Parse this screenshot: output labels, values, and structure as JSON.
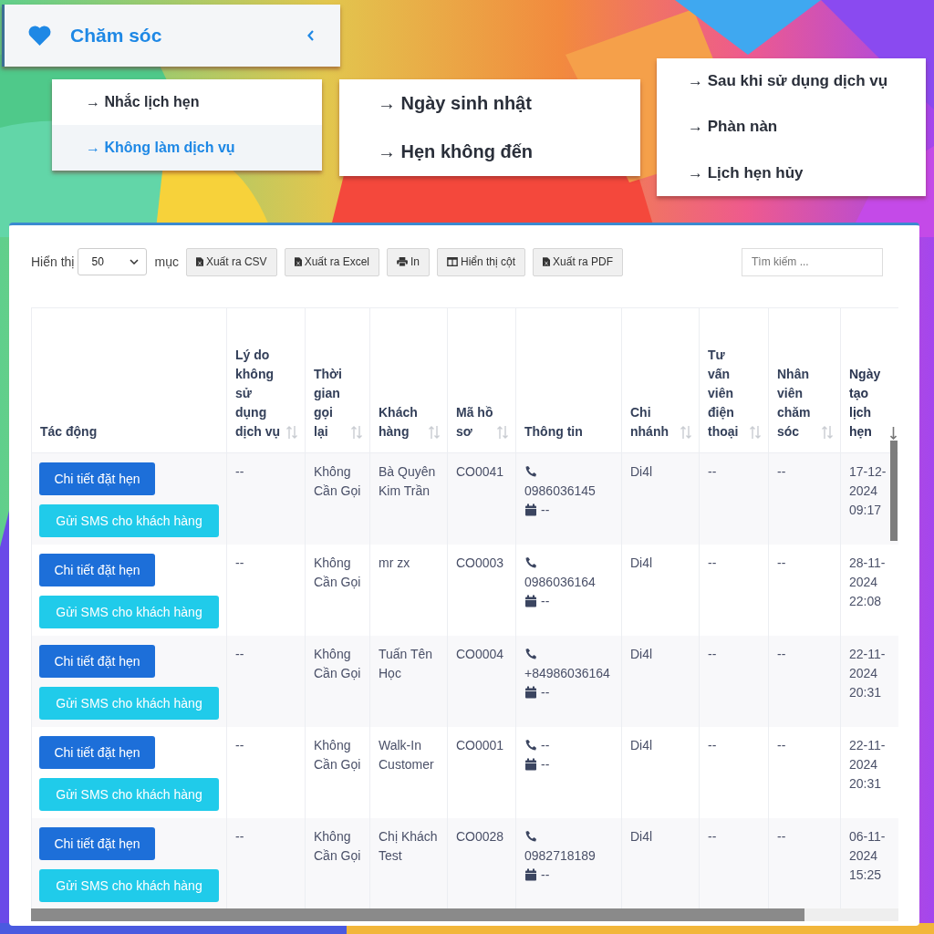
{
  "menu": {
    "title": "Chăm sóc",
    "submenus": [
      {
        "items": [
          {
            "label": "→ Nhắc lịch hẹn",
            "selected": false
          },
          {
            "label": "→ Không làm dịch vụ",
            "selected": true
          }
        ]
      },
      {
        "items": [
          {
            "label": "→ Ngày sinh nhật",
            "selected": false
          },
          {
            "label": "→ Hẹn không đến",
            "selected": false
          }
        ]
      },
      {
        "items": [
          {
            "label": "→ Sau khi sử dụng dịch vụ",
            "selected": false
          },
          {
            "label": "→ Phàn nàn",
            "selected": false
          },
          {
            "label": "→ Lịch hẹn hủy",
            "selected": false
          }
        ]
      }
    ]
  },
  "toolbar": {
    "show_label": "Hiển thị",
    "page_size": "50",
    "entries_label": "mục",
    "buttons": [
      {
        "label": "Xuất ra CSV",
        "kind": "csv"
      },
      {
        "label": "Xuất ra Excel",
        "kind": "excel"
      },
      {
        "label": "In",
        "kind": "print"
      },
      {
        "label": "Hiển thị cột",
        "kind": "columns"
      },
      {
        "label": "Xuất ra PDF",
        "kind": "pdf"
      }
    ],
    "search": {
      "placeholder": "Tìm kiếm ..."
    }
  },
  "table": {
    "columns": [
      {
        "label": "Tác động",
        "sortable": false
      },
      {
        "label": "Lý do không sử dụng dịch vụ",
        "sortable": true,
        "sorted": false
      },
      {
        "label": "Thời gian gọi lại",
        "sortable": true,
        "sorted": false
      },
      {
        "label": "Khách hàng",
        "sortable": true,
        "sorted": false
      },
      {
        "label": "Mã hồ sơ",
        "sortable": true,
        "sorted": false
      },
      {
        "label": "Thông tin",
        "sortable": false
      },
      {
        "label": "Chi nhánh",
        "sortable": true,
        "sorted": false
      },
      {
        "label": "Tư vấn viên điện thoại",
        "sortable": true,
        "sorted": false
      },
      {
        "label": "Nhân viên chăm sóc",
        "sortable": true,
        "sorted": false
      },
      {
        "label": "Ngày tạo lịch hẹn",
        "sortable": true,
        "sorted": true
      }
    ],
    "rows": [
      {
        "actions": [
          "Chi tiết đặt hẹn",
          "Gửi SMS cho khách hàng"
        ],
        "reason": "--",
        "callback": "Không Cần Gọi",
        "customer": "Bà Quyên Kim Trần",
        "record": "CO0041",
        "phone": "0986036145",
        "date": "--",
        "branch": "Di4l",
        "consultant": "--",
        "care_staff": "--",
        "created": "17-12-2024 09:17"
      },
      {
        "actions": [
          "Chi tiết đặt hẹn",
          "Gửi SMS cho khách hàng"
        ],
        "reason": "--",
        "callback": "Không Cần Gọi",
        "customer": "mr zx",
        "record": "CO0003",
        "phone": "0986036164",
        "date": "--",
        "branch": "Di4l",
        "consultant": "--",
        "care_staff": "--",
        "created": "28-11-2024 22:08"
      },
      {
        "actions": [
          "Chi tiết đặt hẹn",
          "Gửi SMS cho khách hàng"
        ],
        "reason": "--",
        "callback": "Không Cần Gọi",
        "customer": "Tuấn Tên Học",
        "record": "CO0004",
        "phone": "+84986036164",
        "date": "--",
        "branch": "Di4l",
        "consultant": "--",
        "care_staff": "--",
        "created": "22-11-2024 20:31"
      },
      {
        "actions": [
          "Chi tiết đặt hẹn",
          "Gửi SMS cho khách hàng"
        ],
        "reason": "--",
        "callback": "Không Cần Gọi",
        "customer": "Walk-In Customer",
        "record": "CO0001",
        "phone": "--",
        "date": "--",
        "branch": "Di4l",
        "consultant": "--",
        "care_staff": "--",
        "created": "22-11-2024 20:31"
      },
      {
        "actions": [
          "Chi tiết đặt hẹn",
          "Gửi SMS cho khách hàng"
        ],
        "reason": "--",
        "callback": "Không Cần Gọi",
        "customer": "Chị Khách Test",
        "record": "CO0028",
        "phone": "0982718189",
        "date": "--",
        "branch": "Di4l",
        "consultant": "--",
        "care_staff": "--",
        "created": "06-11-2024 15:25"
      }
    ]
  }
}
